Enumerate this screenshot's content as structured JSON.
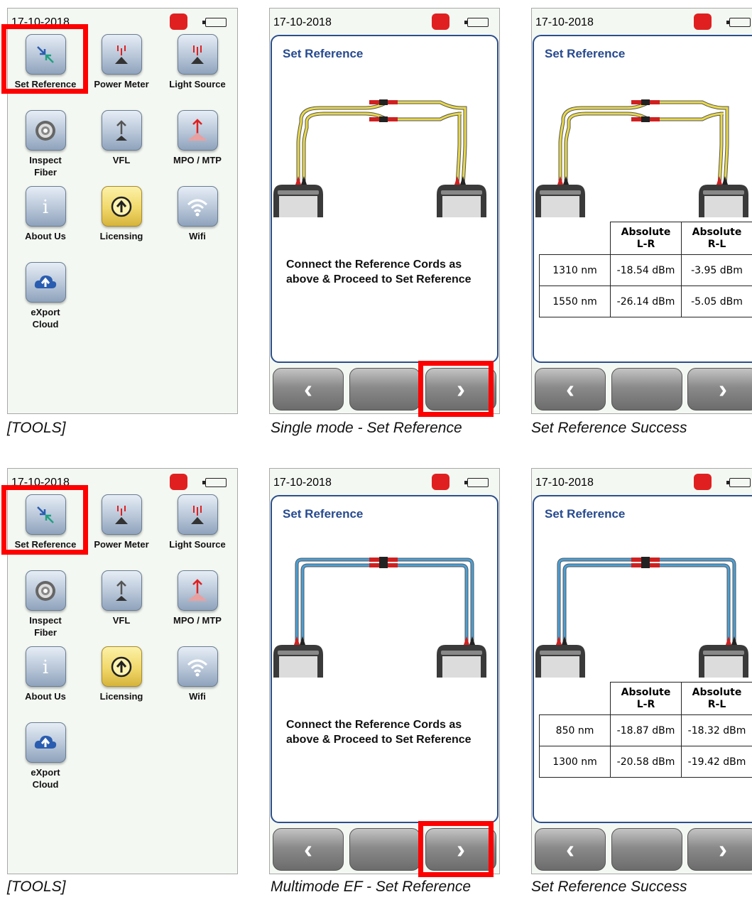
{
  "screens": {
    "tools_top": {
      "date": "17-10-2018",
      "tools": [
        {
          "label": "Set Reference",
          "icon": "set-reference-icon"
        },
        {
          "label": "Power Meter",
          "icon": "power-meter-icon"
        },
        {
          "label": "Light Source",
          "icon": "light-source-icon"
        },
        {
          "label": "Inspect\nFiber",
          "icon": "inspect-fiber-icon"
        },
        {
          "label": "VFL",
          "icon": "vfl-icon"
        },
        {
          "label": "MPO / MTP",
          "icon": "mpo-mtp-icon"
        },
        {
          "label": "About Us",
          "icon": "about-us-icon"
        },
        {
          "label": "Licensing",
          "icon": "licensing-icon"
        },
        {
          "label": "Wifi",
          "icon": "wifi-icon"
        },
        {
          "label": "eXport\nCloud",
          "icon": "export-cloud-icon"
        }
      ]
    },
    "sm_setref": {
      "date": "17-10-2018",
      "title": "Set Reference",
      "message": "Connect the Reference Cords as above & Proceed to Set Reference",
      "cord_color": "#e8d84a"
    },
    "sm_success": {
      "date": "17-10-2018",
      "title": "Set Reference",
      "headers": [
        "Absolute\nL-R",
        "Absolute\nR-L"
      ],
      "rows": [
        {
          "wavelength": "1310 nm",
          "lr": "-18.54 dBm",
          "rl": "-3.95 dBm"
        },
        {
          "wavelength": "1550 nm",
          "lr": "-26.14 dBm",
          "rl": "-5.05 dBm"
        }
      ]
    },
    "tools_bottom": {
      "date": "17-10-2018"
    },
    "mm_setref": {
      "date": "17-10-2018",
      "title": "Set Reference",
      "message": "Connect the Reference Cords as above & Proceed to Set Reference",
      "cord_color": "#4aa0d8"
    },
    "mm_success": {
      "date": "17-10-2018",
      "title": "Set Reference",
      "headers": [
        "Absolute\nL-R",
        "Absolute\nR-L"
      ],
      "rows": [
        {
          "wavelength": "850 nm",
          "lr": "-18.87 dBm",
          "rl": "-18.32 dBm"
        },
        {
          "wavelength": "1300 nm",
          "lr": "-20.58 dBm",
          "rl": "-19.42 dBm"
        }
      ]
    }
  },
  "nav": {
    "prev": "‹",
    "next": "›"
  },
  "captions": {
    "tools_top": "[TOOLS]",
    "sm_setref": "Single mode - Set Reference",
    "sm_success": "Set Reference Success",
    "tools_bottom": "[TOOLS]",
    "mm_setref": "Multimode EF - Set Reference",
    "mm_success": "Set Reference Success"
  },
  "colors": {
    "highlight": "#ff0000",
    "title_blue": "#264a8f",
    "phone_red": "#e02020"
  }
}
